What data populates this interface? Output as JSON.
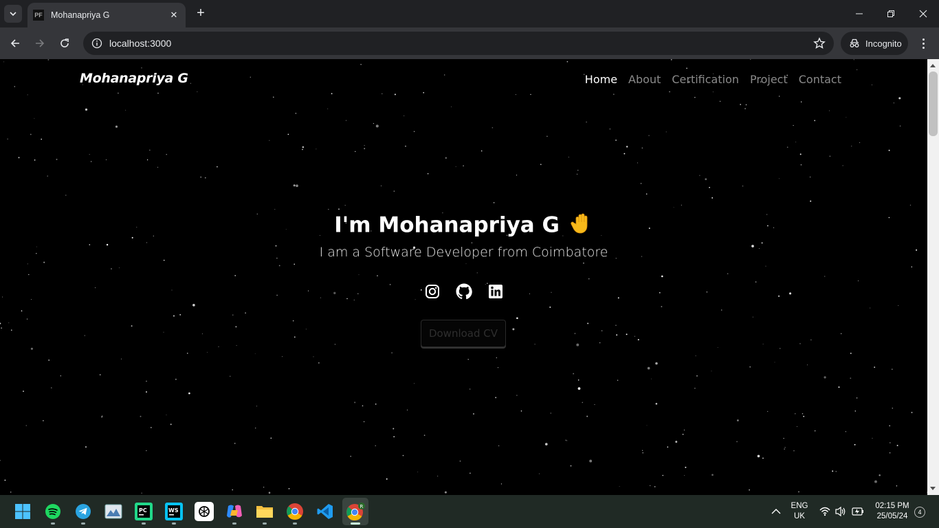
{
  "browser": {
    "tab_title": "Mohanapriya G",
    "favicon_text": "PF",
    "url": "localhost:3000",
    "incognito_label": "Incognito"
  },
  "site": {
    "brand": "Mohanapriya G",
    "nav": [
      {
        "label": "Home",
        "active": true
      },
      {
        "label": "About",
        "active": false
      },
      {
        "label": "Certification",
        "active": false
      },
      {
        "label": "Project",
        "active": false
      },
      {
        "label": "Contact",
        "active": false
      }
    ],
    "hero": {
      "title": "I'm Mohanapriya G",
      "emoji": "waving-hand-icon",
      "subtitle": "I am a Software Developer from Coimbatore",
      "socials": [
        "instagram-icon",
        "github-icon",
        "linkedin-icon"
      ],
      "cta_label": "Download CV"
    }
  },
  "taskbar": {
    "apps": [
      "windows-start-icon",
      "spotify-icon",
      "telegram-icon",
      "photos-icon",
      "pycharm-icon",
      "webstorm-icon",
      "chatgpt-icon",
      "copilot-icon",
      "file-explorer-icon",
      "chrome-icon",
      "vscode-icon",
      "chrome-incognito-icon"
    ],
    "language_line1": "ENG",
    "language_line2": "UK",
    "time": "02:15 PM",
    "date": "25/05/24",
    "notification_count": "4"
  },
  "colors": {
    "page_bg": "#000000",
    "nav_active": "#ffffff",
    "nav_inactive": "#8a8a8a",
    "chrome_dark": "#202124",
    "chrome_mid": "#35363a",
    "taskbar_bg": "#202a25"
  }
}
